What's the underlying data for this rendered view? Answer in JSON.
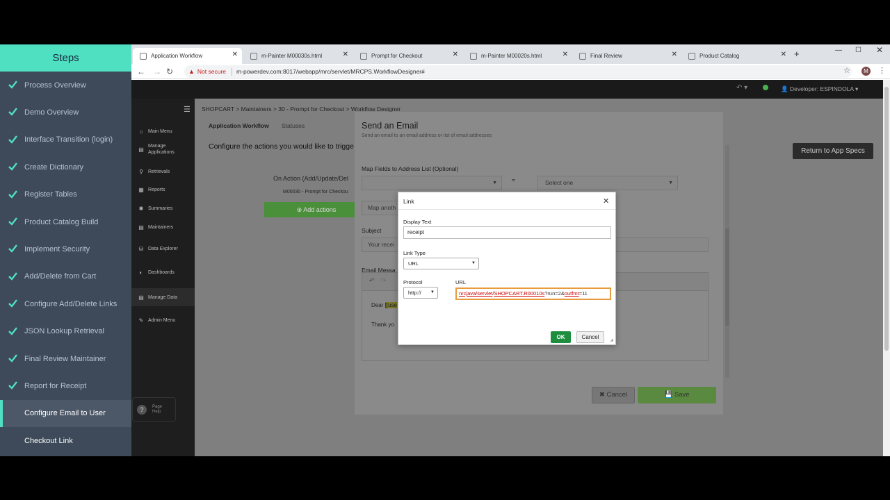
{
  "steps": {
    "title": "Steps",
    "items": [
      {
        "label": "Process Overview",
        "done": true
      },
      {
        "label": "Demo Overview",
        "done": true
      },
      {
        "label": "Interface Transition (login)",
        "done": true
      },
      {
        "label": "Create Dictionary",
        "done": true
      },
      {
        "label": "Register Tables",
        "done": true
      },
      {
        "label": "Product Catalog Build",
        "done": true
      },
      {
        "label": "Implement Security",
        "done": true
      },
      {
        "label": "Add/Delete from Cart",
        "done": true
      },
      {
        "label": "Configure Add/Delete Links",
        "done": true
      },
      {
        "label": "JSON Lookup Retrieval",
        "done": true
      },
      {
        "label": "Final Review Maintainer",
        "done": true
      },
      {
        "label": "Report for Receipt",
        "done": true
      },
      {
        "label": "Configure Email to User",
        "done": false
      },
      {
        "label": "Checkout Link",
        "done": false
      }
    ],
    "active_index": 12,
    "accent": "#4fe0c2"
  },
  "browser": {
    "tabs": [
      {
        "label": "Application Workflow",
        "active": true
      },
      {
        "label": "m-Painter M00030s.html",
        "active": false
      },
      {
        "label": "Prompt for Checkout",
        "active": false
      },
      {
        "label": "m-Painter M00020s.html",
        "active": false
      },
      {
        "label": "Final Review",
        "active": false
      },
      {
        "label": "Product Catalog",
        "active": false
      }
    ],
    "new_tab": "+",
    "security": "Not secure",
    "url": "m-powerdev.com:8017/webapp/mrc/servlet/MRCPS.WorkflowDesigner#",
    "profile_initial": "M"
  },
  "app": {
    "user": "Developer: ESPINDOLA",
    "nav": [
      {
        "label": "Main Menu",
        "icon": "home-icon"
      },
      {
        "label": "Manage Applications",
        "icon": "list-icon"
      },
      {
        "label": "Retrievals",
        "icon": "search-icon"
      },
      {
        "label": "Reports",
        "icon": "chart-icon"
      },
      {
        "label": "Summaries",
        "icon": "gear-icon"
      },
      {
        "label": "Maintainers",
        "icon": "list-icon"
      },
      {
        "label": "Data Explorer",
        "icon": "database-icon"
      },
      {
        "label": "Dashboards",
        "icon": "dashboard-icon"
      },
      {
        "label": "Manage Data",
        "icon": "table-icon"
      },
      {
        "label": "Admin Menu",
        "icon": "wrench-icon"
      }
    ],
    "page_help": "Page Help",
    "breadcrumb": "SHOPCART  >  Maintainers  >  30 - Prompt for Checkout  >  Workflow Designer",
    "subtab_active": "Application Workflow",
    "subtab_other": "Statuses",
    "config_text": "Configure the actions you would like to trigge",
    "on_action": "On Action (Add/Update/Del",
    "module": "M00030 - Prompt for Checkou",
    "add_actions": "Add actions",
    "return_btn": "Return to App Specs"
  },
  "email": {
    "title": "Send an Email",
    "subtitle": "Send an email to an email address or list of email addresses",
    "map_fields_label": "Map Fields to Address List (Optional)",
    "equals": "=",
    "select_one": "Select one",
    "map_another": "Map anoth",
    "subject_label": "Subject",
    "subject_value": "Your recei",
    "message_label": "Email Messa",
    "dear": "Dear",
    "dear_field": "[[use",
    "thank": "Thank yo",
    "cancel": "Cancel",
    "save": "Save"
  },
  "link_dialog": {
    "title": "Link",
    "display_text_label": "Display Text",
    "display_text": "receipt",
    "link_type_label": "Link Type",
    "link_type": "URL",
    "protocol_label": "Protocol",
    "protocol": "http://",
    "url_label": "URL",
    "url_pre": "nrcjava/",
    "url_servlet": "servlet",
    "url_mid": "/",
    "url_pgm": "SHOPCART.R00010s",
    "url_q1": "?run=2&",
    "url_q2": "outfmt",
    "url_q3": "=11",
    "ok": "OK",
    "cancel": "Cancel"
  }
}
